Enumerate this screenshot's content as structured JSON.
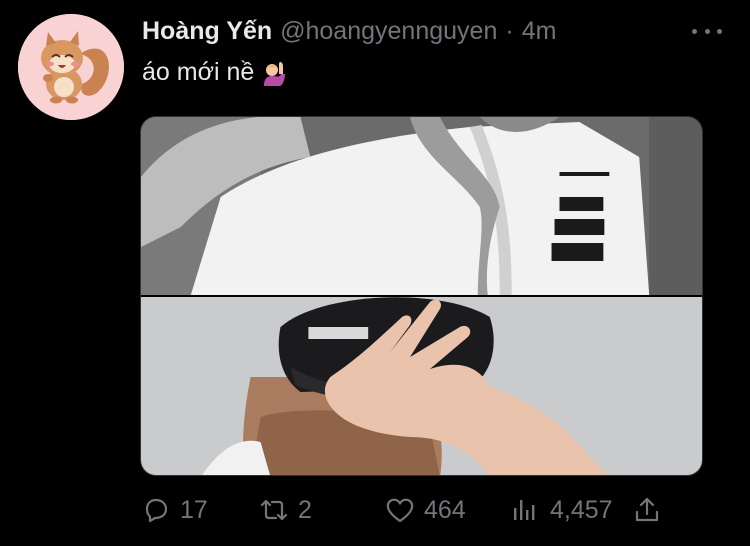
{
  "tweet": {
    "display_name": "Hoàng Yến",
    "handle": "@hoangyennguyen",
    "separator": "·",
    "time": "4m",
    "text": "áo mới nề",
    "emoji": "person-raising-hand-emoji"
  },
  "icons": {
    "avatar": "squirrel-avatar",
    "more": "more-dots-icon",
    "reply": "reply-icon",
    "retweet": "retweet-icon",
    "like": "heart-icon",
    "views": "views-icon",
    "share": "share-icon"
  },
  "actions": {
    "replies": "17",
    "retweets": "2",
    "likes": "464",
    "views": "4,457"
  },
  "colors": {
    "background": "#000000",
    "primary_text": "#e7e9ea",
    "secondary_text": "#71767b",
    "avatar_background": "#f9d3d3"
  }
}
